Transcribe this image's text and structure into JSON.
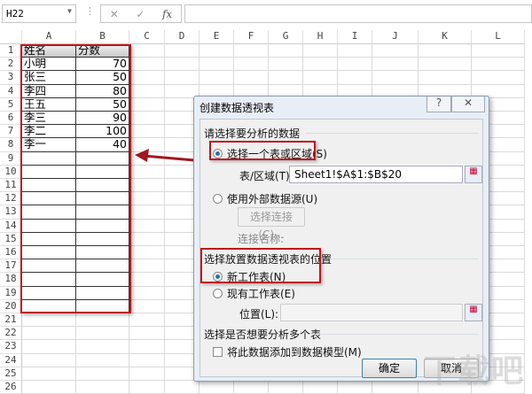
{
  "formula_bar": {
    "name_box": "H22",
    "cancel_icon": "✕",
    "enter_icon": "✓",
    "fx_label": "fx"
  },
  "columns": [
    "A",
    "B",
    "C",
    "D",
    "E",
    "F",
    "G",
    "H",
    "I",
    "J",
    "K",
    "L"
  ],
  "row_count": 26,
  "table": {
    "headers": [
      "姓名",
      "分数"
    ],
    "rows": [
      [
        "小明",
        "70"
      ],
      [
        "张三",
        "50"
      ],
      [
        "李四",
        "80"
      ],
      [
        "王五",
        "50"
      ],
      [
        "李三",
        "90"
      ],
      [
        "李二",
        "100"
      ],
      [
        "李一",
        "40"
      ]
    ]
  },
  "dialog": {
    "title": "创建数据透视表",
    "help": "?",
    "close": "✕",
    "section1": "请选择要分析的数据",
    "opt_range": "选择一个表或区域(S)",
    "range_label": "表/区域(T):",
    "range_value": "Sheet1!$A$1:$B$20",
    "opt_external": "使用外部数据源(U)",
    "choose_conn": "选择连接(C)...",
    "conn_name": "连接名称:",
    "section2": "选择放置数据透视表的位置",
    "opt_new": "新工作表(N)",
    "opt_existing": "现有工作表(E)",
    "location_label": "位置(L):",
    "section3": "选择是否想要分析多个表",
    "add_model": "将此数据添加到数据模型(M)",
    "ok": "确定",
    "cancel": "取消"
  },
  "colors": {
    "highlight": "#c0141b",
    "accent": "#2a6fb0"
  }
}
